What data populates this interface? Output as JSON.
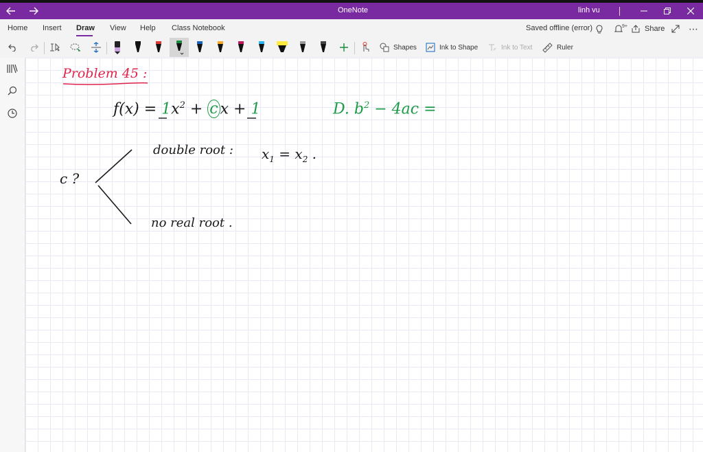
{
  "titlebar": {
    "app_title": "OneNote",
    "user_name": "linh vu",
    "back_icon": "arrow-left-icon",
    "forward_icon": "arrow-right-icon",
    "background": "#7a2aa0"
  },
  "ribbon": {
    "tabs": [
      "Home",
      "Insert",
      "Draw",
      "View",
      "Help",
      "Class Notebook"
    ],
    "active_tab": "Draw",
    "status": "Saved offline (error)",
    "notifications_badge": "9+",
    "share_label": "Share",
    "shapes_label": "Shapes",
    "ink_to_shape_label": "Ink to Shape",
    "ink_to_text_label": "Ink to Text",
    "ruler_label": "Ruler",
    "pen_colors": [
      "#222222",
      "#111111",
      "#e53935",
      "#1b8a3c",
      "#1565c0",
      "#f9a825",
      "#c2185b",
      "#29b6f6",
      "#ffeb3b",
      "#111111",
      "#111111"
    ],
    "add_pen_icon": "plus-icon"
  },
  "rail": {
    "icons": [
      "notebooks-icon",
      "search-icon",
      "recent-clock-icon"
    ]
  },
  "note": {
    "heading": "Problem 45 :",
    "equation_left": "f(x) = ",
    "eq_a": "1",
    "eq_x2": "x",
    "eq_exp": "2",
    "eq_plus": " + ",
    "eq_c": "c",
    "eq_x": "x",
    "eq_plus2": " + ",
    "eq_one": "1",
    "discriminant": "D.  b",
    "disc_exp": "2",
    "disc_rest": " − 4ac  =",
    "c_question": "c ?",
    "double_root": "double root :",
    "double_root_eq": "x",
    "double_root_sub1": "1",
    "double_root_eq_mid": " = x",
    "double_root_sub2": "2",
    "double_root_end": " .",
    "no_real_root": "no  real  root ."
  },
  "colors": {
    "red_ink": "#e0234a",
    "green_ink": "#1f9a49",
    "black_ink": "#1a1a1a"
  }
}
